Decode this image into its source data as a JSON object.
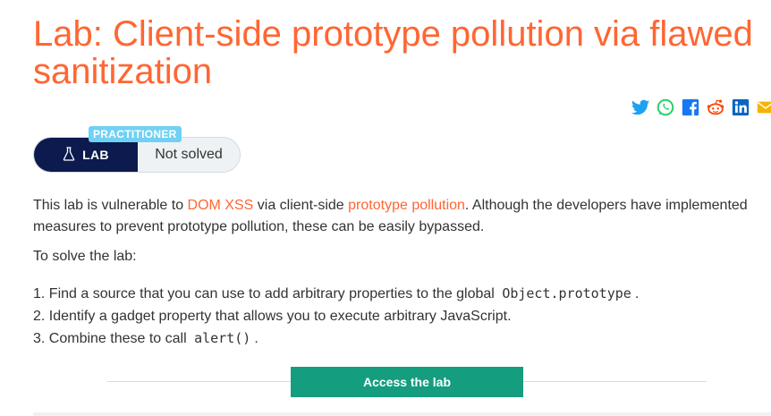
{
  "lab": {
    "title": "Lab: Client-side prototype pollution via flawed sanitization",
    "level": "PRACTITIONER",
    "type_label": "LAB",
    "status": "Not solved"
  },
  "share": {
    "icons": [
      "twitter-icon",
      "whatsapp-icon",
      "facebook-icon",
      "reddit-icon",
      "linkedin-icon",
      "email-icon"
    ],
    "colors": {
      "twitter": "#1da1f2",
      "whatsapp": "#25d366",
      "facebook": "#1877f2",
      "reddit": "#ff4500",
      "linkedin": "#0a66c2",
      "email": "#f4b400"
    }
  },
  "description": {
    "part1": "This lab is vulnerable to ",
    "link1": "DOM XSS",
    "part2": " via client-side ",
    "link2": "prototype pollution",
    "part3": ". Although the developers have implemented measures to prevent prototype pollution, these can be easily bypassed."
  },
  "to_solve": "To solve the lab:",
  "steps": [
    {
      "text": "1. Find a source that you can use to add arbitrary properties to the global ",
      "code": "Object.prototype",
      "end": "."
    },
    {
      "text": "2. Identify a gadget property that allows you to execute arbitrary JavaScript."
    },
    {
      "text": "3. Combine these to call ",
      "code": "alert()",
      "end": "."
    }
  ],
  "access_button": "Access the lab",
  "colors": {
    "accent": "#ff6633",
    "lab_pill": "#0c1a4e",
    "level_badge": "#70d1f4",
    "access_button": "#159d7f"
  }
}
